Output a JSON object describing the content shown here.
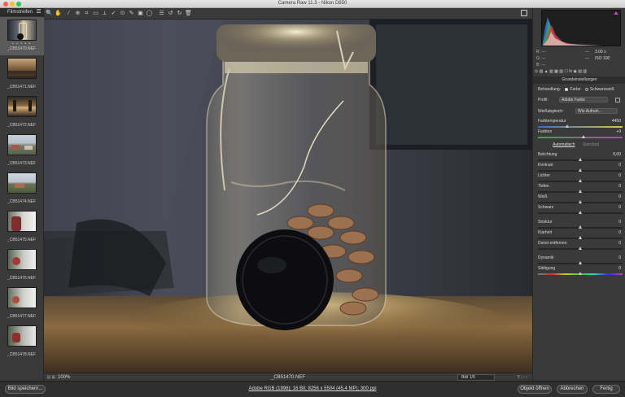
{
  "window": {
    "title": "Camera Raw 11.3 - Nikon D850"
  },
  "filmstrip": {
    "header": "Filmstreifen",
    "items": [
      {
        "name": "_CB51470.NEF",
        "selected": true,
        "rating": "• • • • •"
      },
      {
        "name": "_CB51471.NEF"
      },
      {
        "name": "_CB51472.NEF"
      },
      {
        "name": "_CB51473.NEF"
      },
      {
        "name": "_CB51474.NEF"
      },
      {
        "name": "_CB51475.NEF"
      },
      {
        "name": "_CB51476.NEF"
      },
      {
        "name": "_CB51477.NEF"
      },
      {
        "name": "_CB51478.NEF"
      }
    ]
  },
  "toolbar": {
    "tools": [
      "zoom-icon",
      "hand-icon",
      "white-balance-icon",
      "color-sampler-icon",
      "crop-icon",
      "straighten-icon",
      "transform-icon",
      "spot-removal-icon",
      "red-eye-icon",
      "adjustment-brush-icon",
      "graduated-filter-icon",
      "radial-filter-icon",
      "preferences-icon",
      "rotate-ccw-icon",
      "rotate-cw-icon",
      "trash-icon"
    ],
    "glyphs": [
      "🔍",
      "✋",
      "⁄",
      "⊕",
      "⌗",
      "▭",
      "⟂",
      "✓",
      "⊙",
      "✎",
      "▣",
      "◯",
      "☰",
      "↺",
      "↻",
      "🗑"
    ]
  },
  "status": {
    "zoom": "100%",
    "filename": "_CB51470.NEF",
    "image_count": "Bild 1/9",
    "zoom_minus": "⊟",
    "zoom_plus": "⊞",
    "icons": "Y  ⁝  ▫  ▫"
  },
  "histogram": {
    "r": "R:",
    "g": "G:",
    "b": "B:",
    "dash": "---",
    "aperture": "---",
    "shutter": "3.00 s",
    "iso": "ISO 100",
    "focal": "---"
  },
  "panel_icons": "⊙ ▤ ▲ ▧ ▦ ▨ ☐ fx ◉ ▤ ▥",
  "basic": {
    "title": "Grundeinstellungen",
    "treatment_label": "Behandlung:",
    "treatment_color": "Farbe",
    "treatment_bw": "Schwarzweiß",
    "profile_label": "Profil:",
    "profile_value": "Adobe Farbe",
    "wb_label": "Weißabgleich:",
    "wb_value": "Wie Aufnah...",
    "temp_label": "Farbtemperatur",
    "temp_value": "4450",
    "tint_label": "Farbton",
    "tint_value": "+9",
    "auto_label": "Automatisch",
    "default_label": "Standard",
    "sliders": [
      {
        "label": "Belichtung",
        "value": "0,00"
      },
      {
        "label": "Kontrast",
        "value": "0"
      },
      {
        "label": "Lichter",
        "value": "0"
      },
      {
        "label": "Tiefen",
        "value": "0"
      },
      {
        "label": "Weiß",
        "value": "0"
      },
      {
        "label": "Schwarz",
        "value": "0"
      },
      {
        "label": "Struktur",
        "value": "0"
      },
      {
        "label": "Klarheit",
        "value": "0"
      },
      {
        "label": "Dunst entfernen",
        "value": "0"
      },
      {
        "label": "Dynamik",
        "value": "0"
      },
      {
        "label": "Sättigung",
        "value": "0"
      }
    ]
  },
  "bottom": {
    "save": "Bild speichern...",
    "info": "Adobe RGB (1998); 16 Bit; 8256 x 5504 (45,4 MP); 300 ppi",
    "open": "Objekt öffnen",
    "cancel": "Abbrechen",
    "done": "Fertig"
  }
}
